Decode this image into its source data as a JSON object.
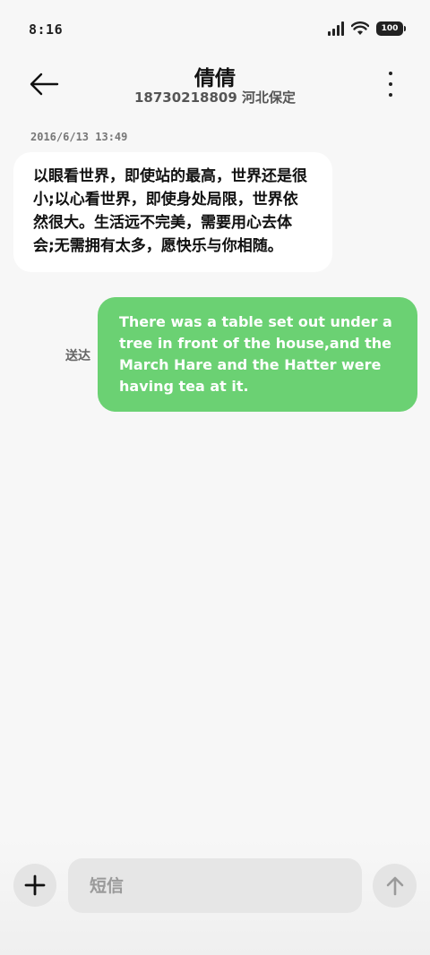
{
  "status_bar": {
    "time": "8:16",
    "battery": "100"
  },
  "header": {
    "contact_name": "倩倩",
    "contact_detail": "18730218809 河北保定"
  },
  "messages": {
    "timestamp": "2016/6/13 13:49",
    "incoming_text": "以眼看世界，即使站的最高，世界还是很小;以心看世界，即使身处局限，世界依然很大。生活远不完美，需要用心去体会;无需拥有太多，愿快乐与你相随。",
    "outgoing_text": "There was a table set out under a tree in front of the house,and the March Hare and the Hatter were having tea at it.",
    "outgoing_status": "送达"
  },
  "composer": {
    "placeholder": "短信"
  },
  "colors": {
    "outgoing_bubble": "#6bd173",
    "incoming_bubble": "#ffffff",
    "background": "#f7f7f7"
  }
}
